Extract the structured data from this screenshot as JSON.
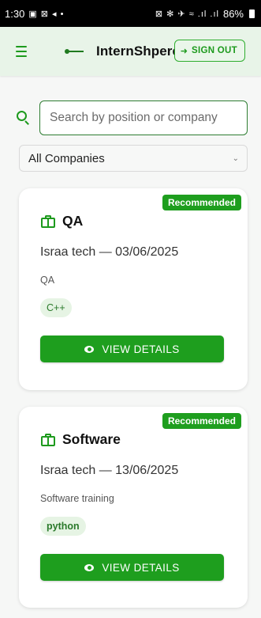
{
  "status_bar": {
    "time": "1:30",
    "left_icons": "▣ ⊠ ◂ •",
    "right_icons": "⊠ ✻ ✈ ≈ .ıl .ıl",
    "battery": "86%"
  },
  "header": {
    "title": "InternShpere",
    "signout_label": "SIGN OUT",
    "menu_icon": "hamburger-menu-icon",
    "logo_icon": "app-logo-icon",
    "signout_icon": "sign-out-icon"
  },
  "search": {
    "placeholder": "Search by position or company",
    "value": "",
    "icon": "search-icon"
  },
  "filter": {
    "selected": "All Companies"
  },
  "internships": [
    {
      "badge": "Recommended",
      "title": "QA",
      "company_date": "Israa tech — 03/06/2025",
      "description": "QA",
      "tag": "C++",
      "button_label": "VIEW DETAILS"
    },
    {
      "badge": "Recommended",
      "title": "Software",
      "company_date": "Israa tech — 13/06/2025",
      "description": "Software training",
      "tag": "python",
      "button_label": "VIEW DETAILS"
    }
  ],
  "colors": {
    "accent": "#1e9e1e",
    "header_bg": "#e8f4e8",
    "tag_bg": "#e6f4e4"
  }
}
